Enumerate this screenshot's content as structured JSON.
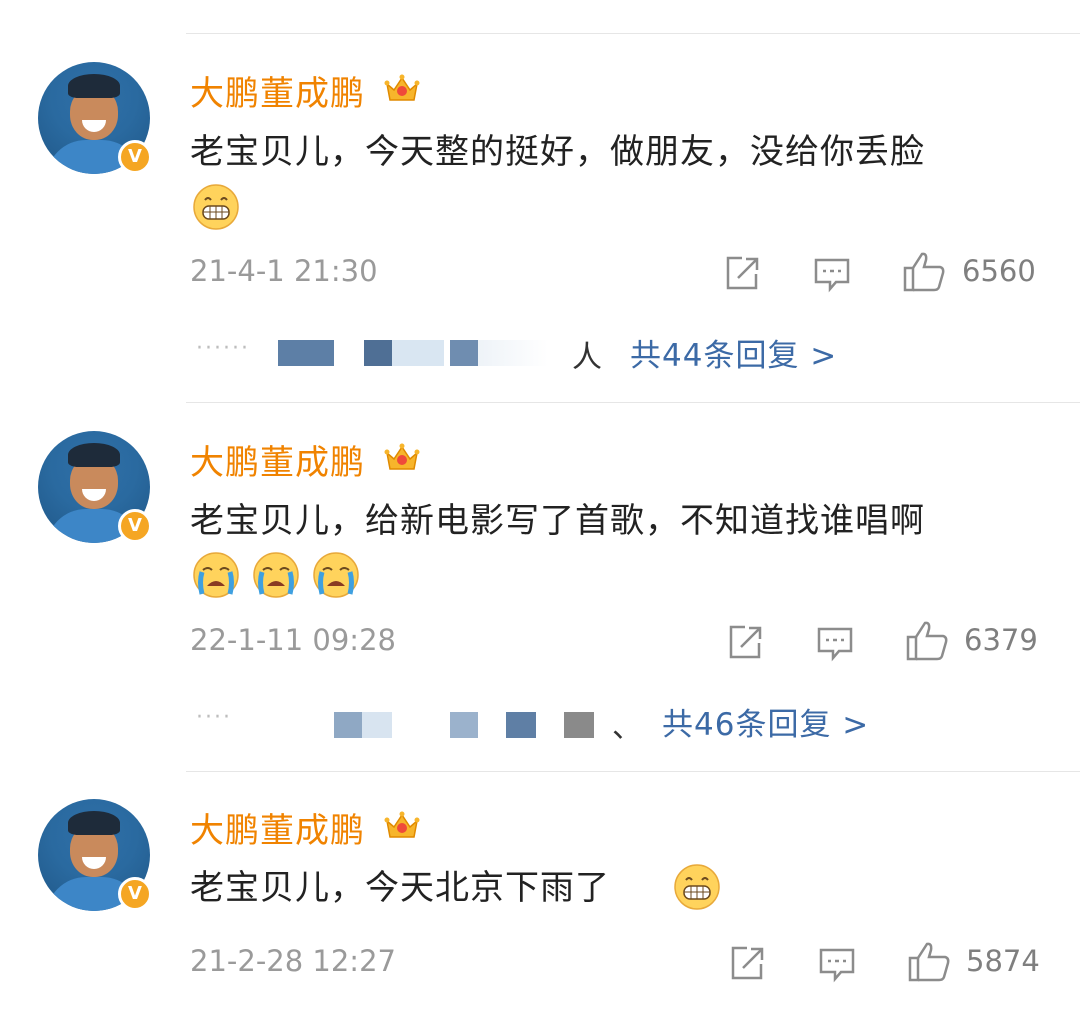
{
  "comments": [
    {
      "username": "大鹏董成鹏",
      "text": "老宝贝儿，今天整的挺好，做朋友，没给你丢脸",
      "emojis": [
        "grin-emoji"
      ],
      "time": "21-4-1 21:30",
      "likes": "6560",
      "reply_names_tail": "人",
      "reply_link": "共44条回复 >"
    },
    {
      "username": "大鹏董成鹏",
      "text": "老宝贝儿，给新电影写了首歌，不知道找谁唱啊",
      "emojis": [
        "crying-emoji",
        "crying-emoji",
        "crying-emoji"
      ],
      "time": "22-1-11 09:28",
      "likes": "6379",
      "reply_names_tail": "、",
      "reply_link": "共46条回复 >"
    },
    {
      "username": "大鹏董成鹏",
      "text": "老宝贝儿，今天北京下雨了",
      "emojis": [
        "grin-emoji"
      ],
      "time": "21-2-28 12:27",
      "likes": "5874"
    }
  ],
  "colors": {
    "username": "#f08300",
    "link": "#3c6aa6",
    "meta": "#9a9a9a",
    "badge": "#f5a623"
  },
  "icons": [
    "crown-icon",
    "verified-badge-icon",
    "repost-icon",
    "comment-icon",
    "like-icon"
  ]
}
